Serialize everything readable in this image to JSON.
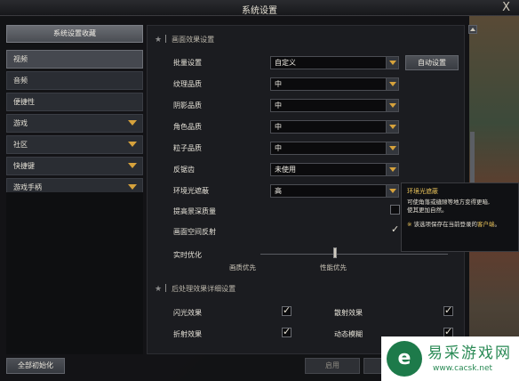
{
  "window": {
    "title": "系统设置",
    "close_glyph": "X"
  },
  "sidebar": {
    "header_button": "系统设置收藏",
    "items": [
      {
        "label": "视频",
        "active": true,
        "expandable": false
      },
      {
        "label": "音频",
        "active": false,
        "expandable": false
      },
      {
        "label": "便捷性",
        "active": false,
        "expandable": false
      },
      {
        "label": "游戏",
        "active": false,
        "expandable": true
      },
      {
        "label": "社区",
        "active": false,
        "expandable": true
      },
      {
        "label": "快捷键",
        "active": false,
        "expandable": true
      },
      {
        "label": "游戏手柄",
        "active": false,
        "expandable": true
      }
    ],
    "reset_button": "全部初始化"
  },
  "content": {
    "section_picture": "画面效果设置",
    "rows": [
      {
        "label": "批量设置",
        "value": "自定义"
      },
      {
        "label": "纹理品质",
        "value": "中"
      },
      {
        "label": "阴影品质",
        "value": "中"
      },
      {
        "label": "角色品质",
        "value": "中"
      },
      {
        "label": "粒子品质",
        "value": "中"
      },
      {
        "label": "反锯齿",
        "value": "未使用"
      },
      {
        "label": "环境光遮蔽",
        "value": "高"
      }
    ],
    "auto_button": "自动设置",
    "checkbox_rows": [
      {
        "label": "提高景深质量",
        "checked": false
      },
      {
        "label": "画面空间反射",
        "checked": true
      }
    ],
    "realtime": {
      "label": "实时优化",
      "left_label": "画质优先",
      "right_label": "性能优先",
      "value": 0.42
    },
    "section_post": "后处理效果详细设置",
    "post_items": [
      {
        "label": "闪光效果",
        "checked": true
      },
      {
        "label": "散射效果",
        "checked": true
      },
      {
        "label": "折射效果",
        "checked": true
      },
      {
        "label": "动态模糊",
        "checked": true
      }
    ]
  },
  "tooltip": {
    "title": "环境光遮蔽",
    "lines": [
      "可使角落或缝隙等地方变得更暗,",
      "使其更加自然。"
    ],
    "note_bullet": "※",
    "note_prefix": "该选项保存在当前登录的",
    "note_highlight": "客户端",
    "note_suffix": "。"
  },
  "footer": {
    "apply_button": "启用"
  },
  "watermark": {
    "logo_glyph": "e",
    "name": "易采游戏网",
    "url": "www.cacsk.net"
  }
}
